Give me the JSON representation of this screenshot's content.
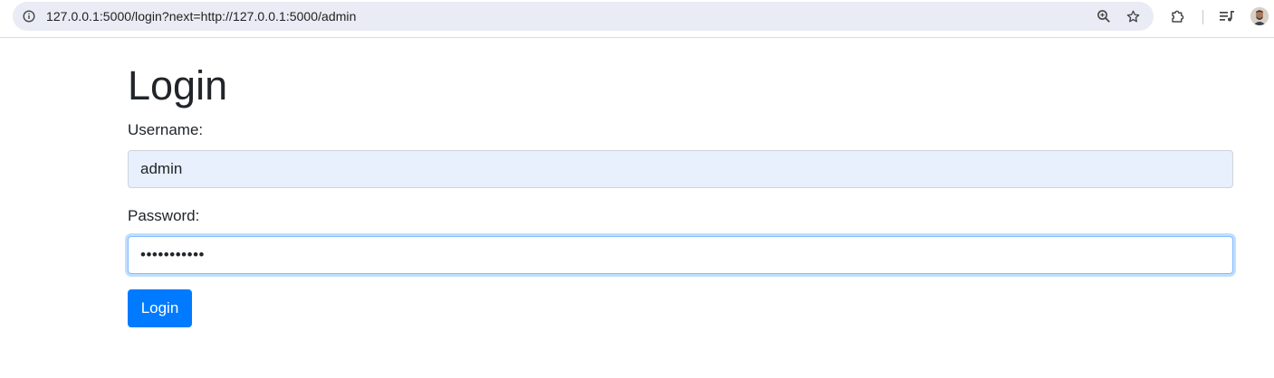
{
  "browser": {
    "url": "127.0.0.1:5000/login?next=http://127.0.0.1:5000/admin",
    "icons": {
      "site_info": "info-icon",
      "zoom": "zoom-icon",
      "bookmark": "star-icon",
      "extensions": "puzzle-icon",
      "media": "media-playlist-icon",
      "profile": "avatar"
    }
  },
  "page": {
    "title": "Login",
    "username_label": "Username:",
    "username_value": "admin",
    "password_label": "Password:",
    "password_value": "adminadmin1",
    "submit_label": "Login"
  },
  "colors": {
    "primary": "#007bff",
    "autofill_bg": "#e8f0fe",
    "focus_border": "#80bdff",
    "text": "#212529"
  }
}
